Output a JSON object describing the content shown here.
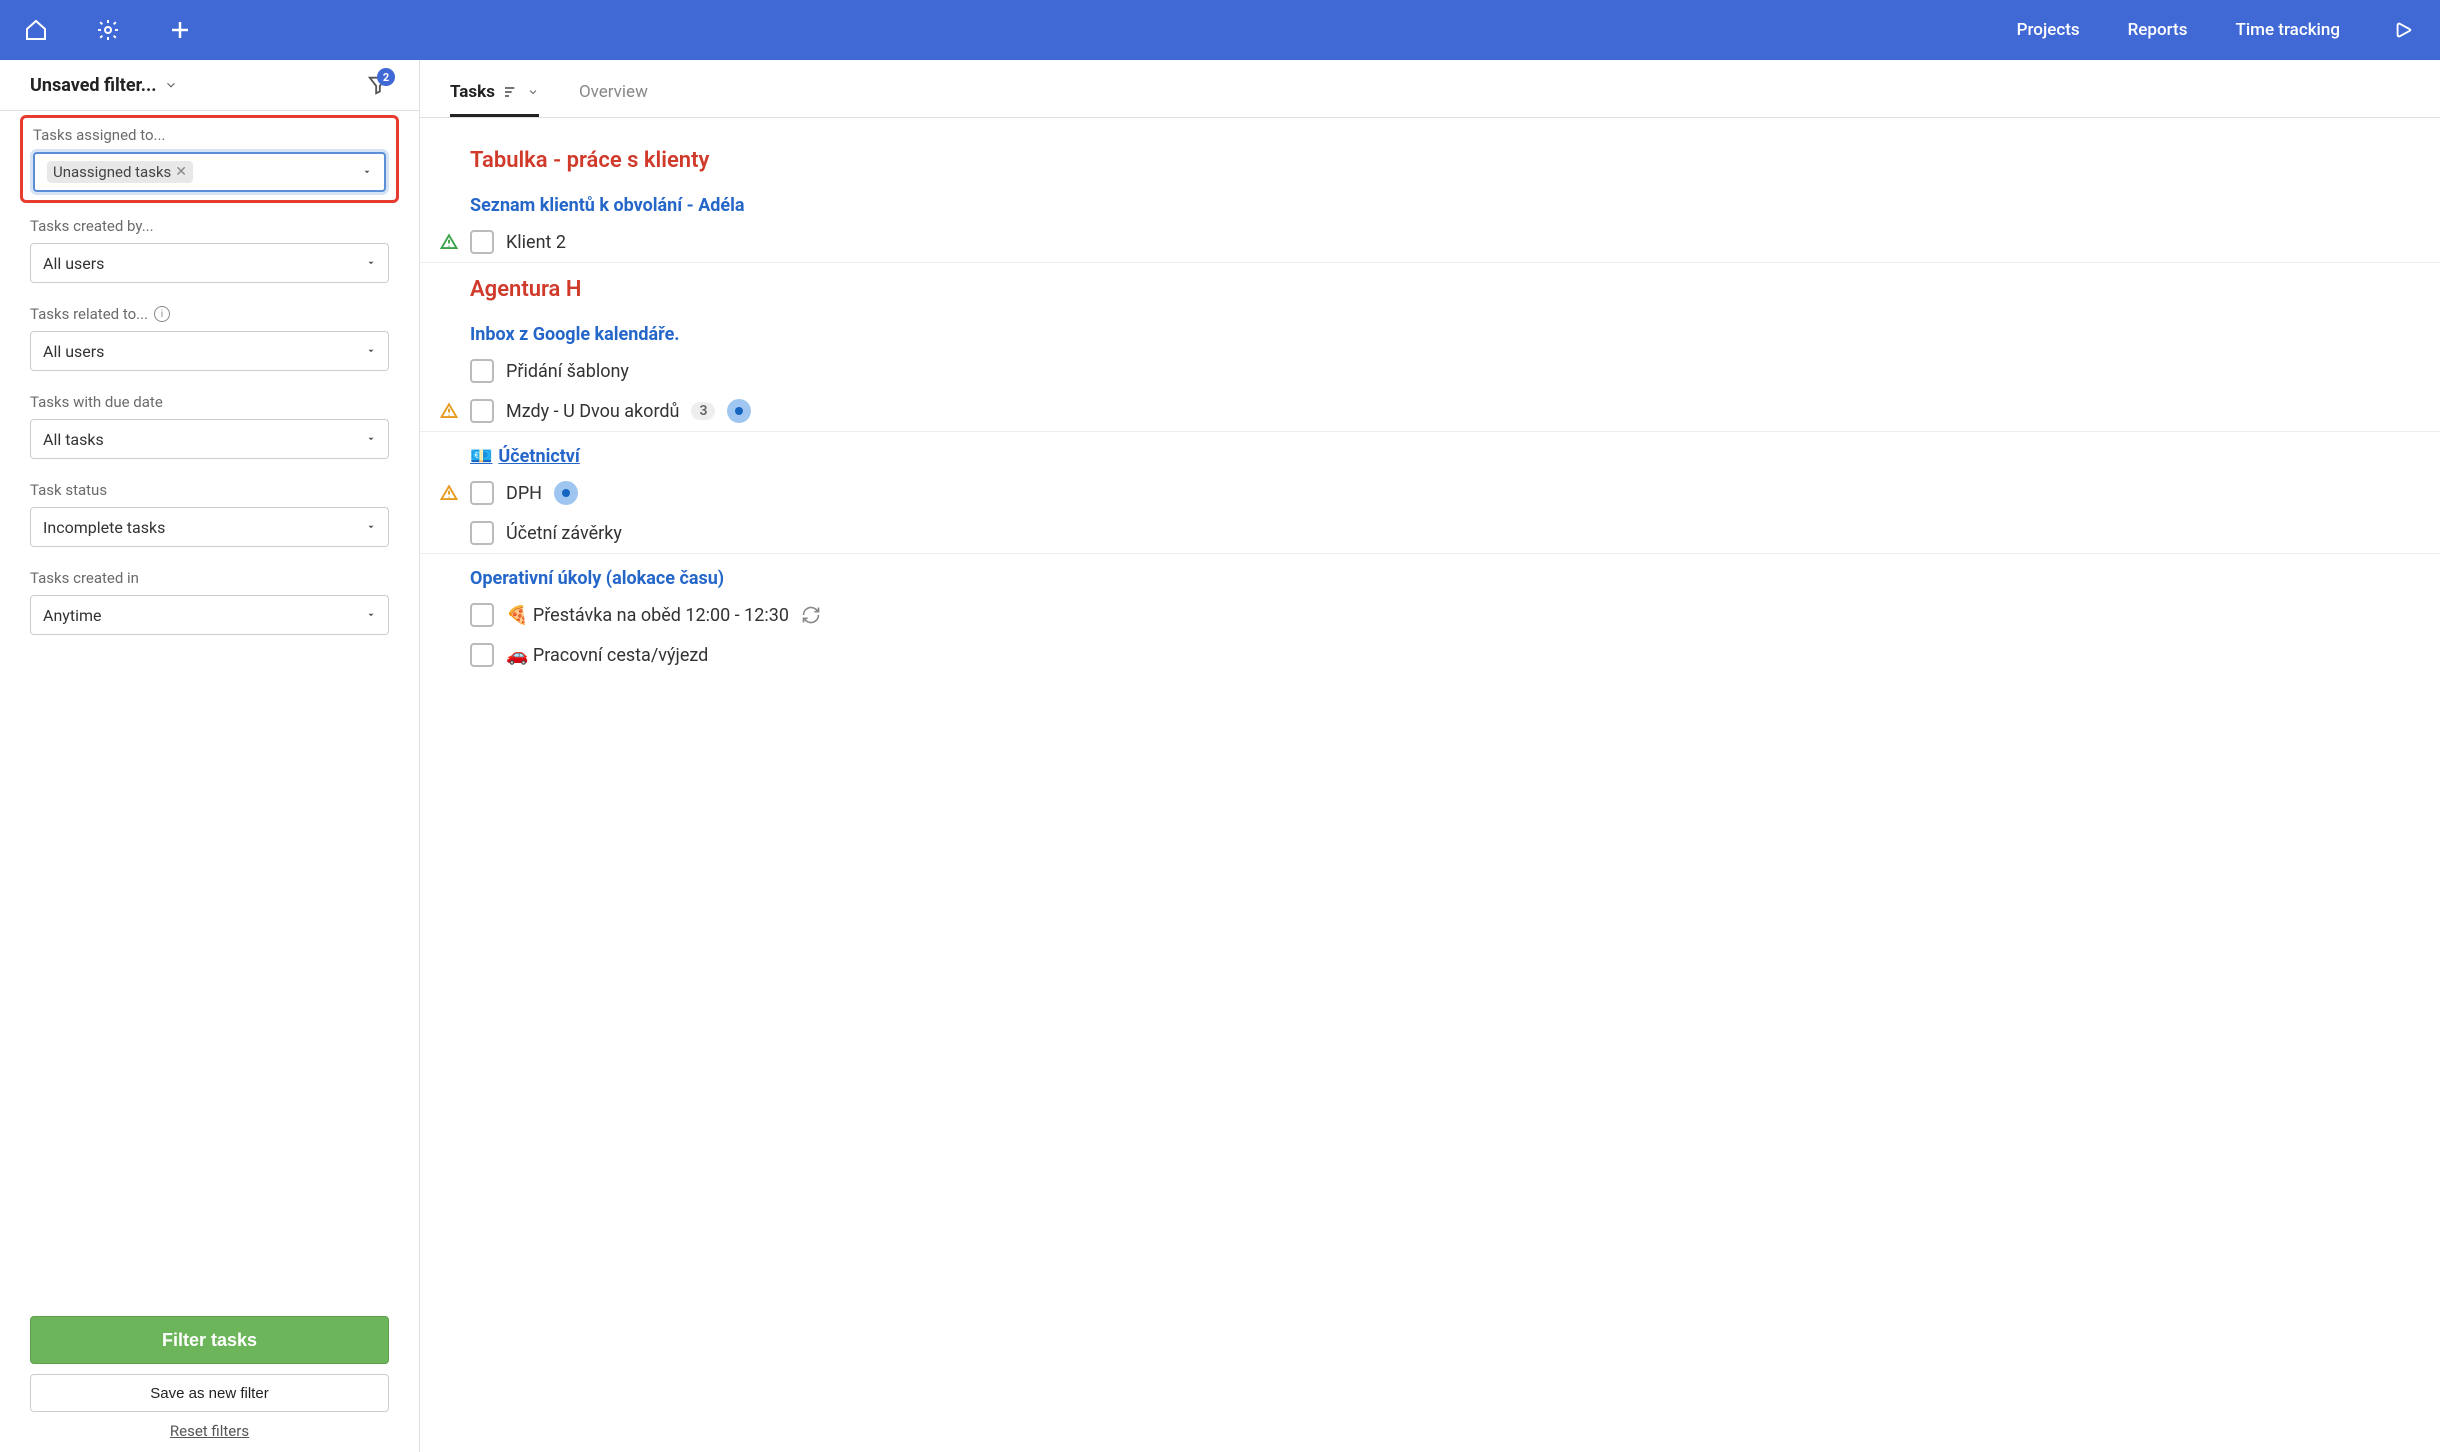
{
  "topnav": {
    "projects": "Projects",
    "reports": "Reports",
    "time_tracking": "Time tracking"
  },
  "sidebar": {
    "title": "Unsaved filter...",
    "filter_badge": "2",
    "filters": {
      "assigned_to": {
        "label": "Tasks assigned to...",
        "chip": "Unassigned tasks"
      },
      "created_by": {
        "label": "Tasks created by...",
        "value": "All users"
      },
      "related_to": {
        "label": "Tasks related to...",
        "value": "All users"
      },
      "due_date": {
        "label": "Tasks with due date",
        "value": "All tasks"
      },
      "status": {
        "label": "Task status",
        "value": "Incomplete tasks"
      },
      "created_in": {
        "label": "Tasks created in",
        "value": "Anytime"
      }
    },
    "filter_btn": "Filter tasks",
    "save_btn": "Save as new filter",
    "reset": "Reset filters"
  },
  "content": {
    "tabs": {
      "tasks": "Tasks",
      "overview": "Overview"
    },
    "projects": [
      {
        "title": "Tabulka - práce s klienty",
        "lists": [
          {
            "title": "Seznam klientů k obvolání - Adéla",
            "tasks": [
              {
                "priority": "high-green",
                "label": "Klient 2"
              }
            ]
          }
        ]
      },
      {
        "title": "Agentura H",
        "lists": [
          {
            "title": "Inbox z Google kalendáře.",
            "tasks": [
              {
                "label": "Přidání šablony"
              },
              {
                "priority": "med-orange",
                "label": "Mzdy - U Dvou akordů",
                "count": "3",
                "dot": true
              }
            ]
          },
          {
            "title": "Účetnictví",
            "underlined": true,
            "emoji": "💶",
            "tasks": [
              {
                "priority": "med-orange",
                "label": "DPH",
                "dot": true
              },
              {
                "label": "Účetní závěrky"
              }
            ]
          },
          {
            "title": "Operativní úkoly (alokace času)",
            "tasks": [
              {
                "label": "🍕 Přestávka na oběd 12:00 - 12:30",
                "recur": true
              },
              {
                "label": "🚗 Pracovní cesta/výjezd"
              }
            ]
          }
        ]
      }
    ]
  }
}
